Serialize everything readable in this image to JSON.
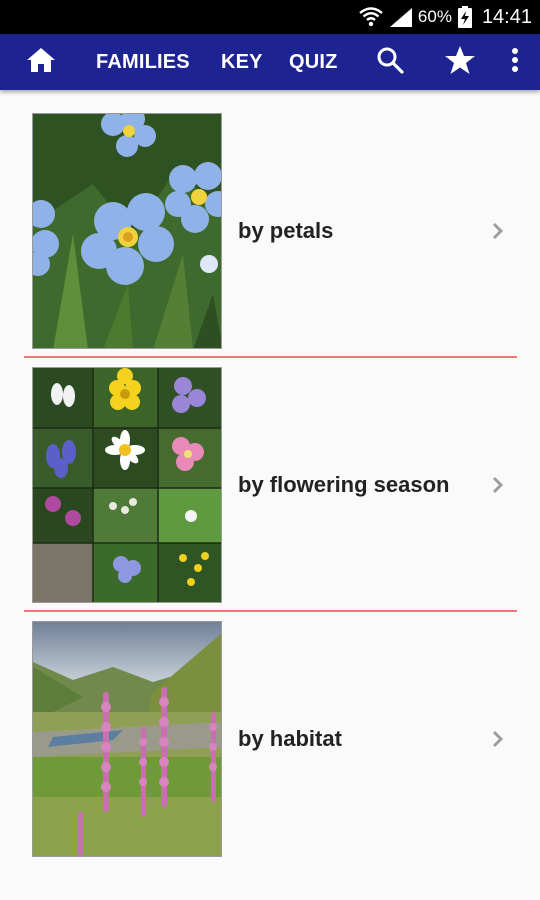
{
  "status_bar": {
    "battery_percent": "60%",
    "time": "14:41",
    "icons": [
      "wifi-icon",
      "signal-icon",
      "battery-charging-icon"
    ]
  },
  "app_bar": {
    "background_color": "#1d2491",
    "home_icon": "home-icon",
    "tabs": [
      {
        "label": "FAMILIES"
      },
      {
        "label": "KEY"
      },
      {
        "label": "QUIZ"
      }
    ],
    "actions": [
      "search-icon",
      "star-icon",
      "more-vert-icon"
    ]
  },
  "list": {
    "divider_color": "#ec7a7a",
    "items": [
      {
        "label": "by petals",
        "image": "forget-me-not flowers"
      },
      {
        "label": "by flowering season",
        "image": "collage of wildflowers"
      },
      {
        "label": "by habitat",
        "image": "foxgloves in valley"
      }
    ]
  }
}
